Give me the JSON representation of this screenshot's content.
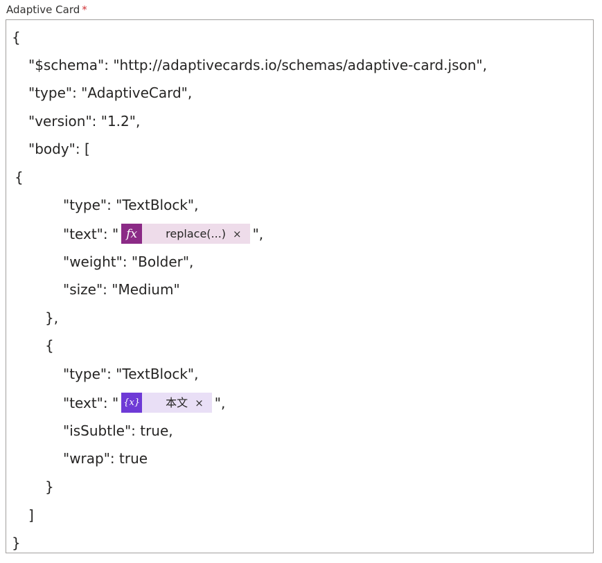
{
  "field": {
    "label": "Adaptive Card",
    "required_mark": "*"
  },
  "editor": {
    "lines": [
      "{",
      "\"$schema\": \"http://adaptivecards.io/schemas/adaptive-card.json\",",
      "\"type\": \"AdaptiveCard\",",
      "\"version\": \"1.2\",",
      "\"body\": [",
      "{",
      "\"type\": \"TextBlock\",",
      "\"weight\": \"Bolder\",",
      "\"size\": \"Medium\"",
      "},",
      "{",
      "\"type\": \"TextBlock\",",
      "\"isSubtle\": true,",
      "\"wrap\": true",
      "}",
      "]",
      "}"
    ],
    "text_line_1": {
      "prefix": "\"text\": \"",
      "suffix": "\",",
      "token": {
        "kind": "expression",
        "icon": "fx-icon",
        "badge": "fx",
        "label": "replace(...)",
        "close": "×",
        "color": "#8b2a86"
      }
    },
    "text_line_2": {
      "prefix": "\"text\": \"",
      "suffix": "\",",
      "token": {
        "kind": "variable",
        "icon": "variable-icon",
        "badge": "{x}",
        "label": "本文",
        "close": "×",
        "color": "#6e3ad6"
      }
    }
  }
}
